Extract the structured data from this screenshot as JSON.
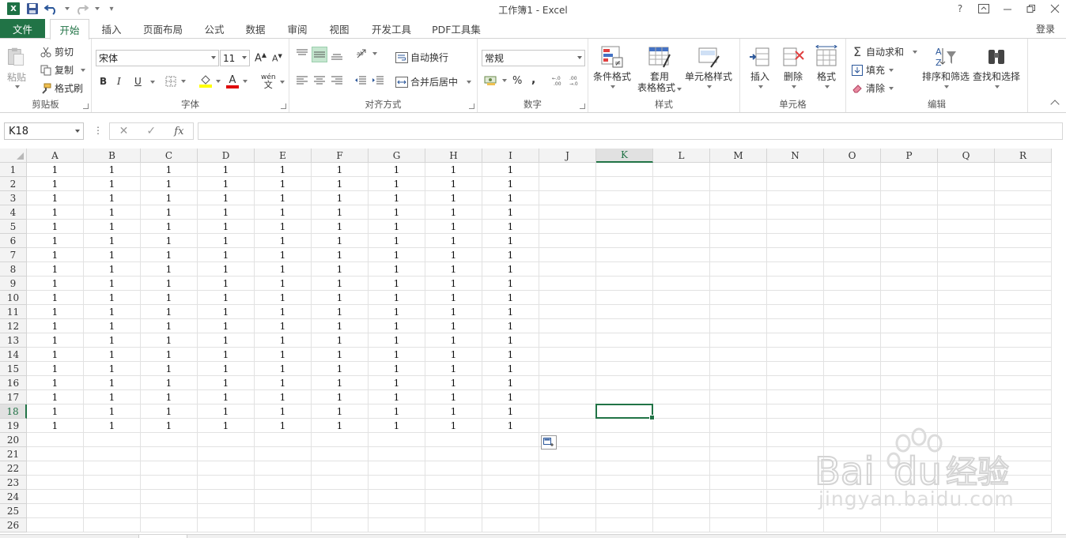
{
  "window": {
    "title": "工作簿1 - Excel",
    "help": "?",
    "login": "登录"
  },
  "tabs": [
    "文件",
    "开始",
    "插入",
    "页面布局",
    "公式",
    "数据",
    "审阅",
    "视图",
    "开发工具",
    "PDF工具集"
  ],
  "active_tab_index": 1,
  "ribbon": {
    "clipboard": {
      "label": "剪贴板",
      "paste": "粘贴",
      "cut": "剪切",
      "copy": "复制",
      "format_painter": "格式刷"
    },
    "font": {
      "label": "字体",
      "font_name": "宋体",
      "font_size": "11",
      "bold": "B",
      "italic": "I",
      "underline": "U",
      "wen": "wén"
    },
    "alignment": {
      "label": "对齐方式",
      "wrap": "自动换行",
      "merge": "合并后居中"
    },
    "number": {
      "label": "数字",
      "format": "常规",
      "percent": "%",
      "comma": ","
    },
    "styles": {
      "label": "样式",
      "conditional": "条件格式",
      "table_format_1": "套用",
      "table_format_2": "表格格式",
      "cell_styles": "单元格样式"
    },
    "cells": {
      "label": "单元格",
      "insert": "插入",
      "delete": "删除",
      "format": "格式"
    },
    "editing": {
      "label": "编辑",
      "autosum": "自动求和",
      "fill": "填充",
      "clear": "清除",
      "sort": "排序和筛选",
      "find": "查找和选择"
    }
  },
  "formula_bar": {
    "name_box": "K18",
    "fx": "fx",
    "value": ""
  },
  "columns": [
    "A",
    "B",
    "C",
    "D",
    "E",
    "F",
    "G",
    "H",
    "I",
    "J",
    "K",
    "L",
    "M",
    "N",
    "O",
    "P",
    "Q",
    "R"
  ],
  "rows": [
    "1",
    "2",
    "3",
    "4",
    "5",
    "6",
    "7",
    "8",
    "9",
    "10",
    "11",
    "12",
    "13",
    "14",
    "15",
    "16",
    "17",
    "18",
    "19",
    "20",
    "21",
    "22",
    "23",
    "24",
    "25",
    "26"
  ],
  "selected_cell": {
    "column": "K",
    "row": "18"
  },
  "data_range": {
    "rows": 19,
    "columns": 9,
    "value": "1"
  },
  "watermark": {
    "brand": "Baidu经验",
    "url": "jingyan.baidu.com"
  }
}
